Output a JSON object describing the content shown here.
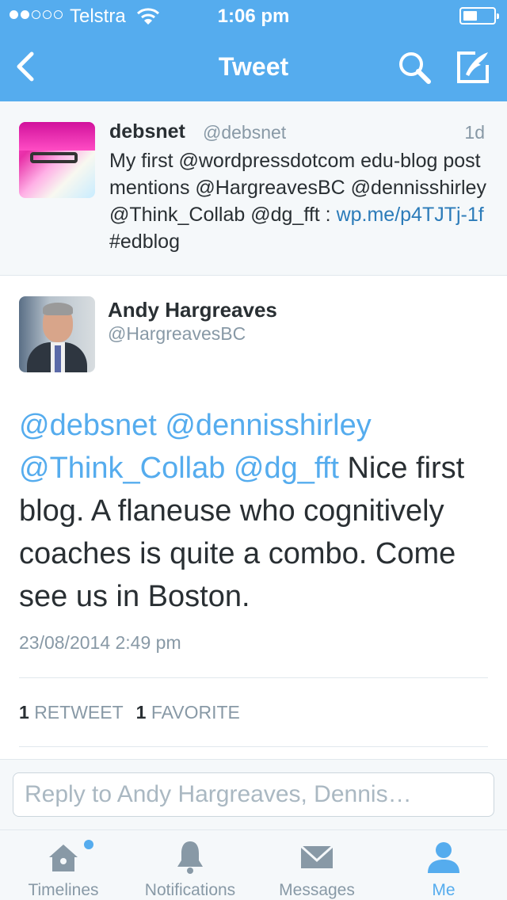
{
  "status": {
    "carrier": "Telstra",
    "time": "1:06 pm"
  },
  "nav": {
    "title": "Tweet",
    "icons": [
      "back-chevron-icon",
      "search-icon",
      "compose-icon"
    ]
  },
  "parent_tweet": {
    "name": "debsnet",
    "handle": "@debsnet",
    "age": "1d",
    "text_1": "My first @wordpressdotcom edu-blog post mentions @HargreavesBC @dennisshirley @Think_Collab @dg_fft : ",
    "link": "wp.me/p4TJTj-1f",
    "text_2": " #edblog"
  },
  "tweet": {
    "name": "Andy Hargreaves",
    "handle": "@HargreavesBC",
    "mentions": "@debsnet @dennisshirley @Think_Collab @dg_fft",
    "body": " Nice first blog. A flaneuse who cognitively coaches is quite a combo. Come see us in Boston.",
    "timestamp": "23/08/2014 2:49 pm",
    "retweet_count": "1",
    "retweet_label": "RETWEET",
    "favorite_count": "1",
    "favorite_label": "FAVORITE"
  },
  "reply": {
    "placeholder": "Reply to Andy Hargreaves, Dennis…"
  },
  "tabs": [
    {
      "label": "Timelines",
      "icon": "home-icon"
    },
    {
      "label": "Notifications",
      "icon": "bell-icon"
    },
    {
      "label": "Messages",
      "icon": "envelope-icon"
    },
    {
      "label": "Me",
      "icon": "person-icon"
    }
  ],
  "colors": {
    "accent": "#55acee",
    "link": "#2b7bb9",
    "muted": "#8899a6"
  }
}
